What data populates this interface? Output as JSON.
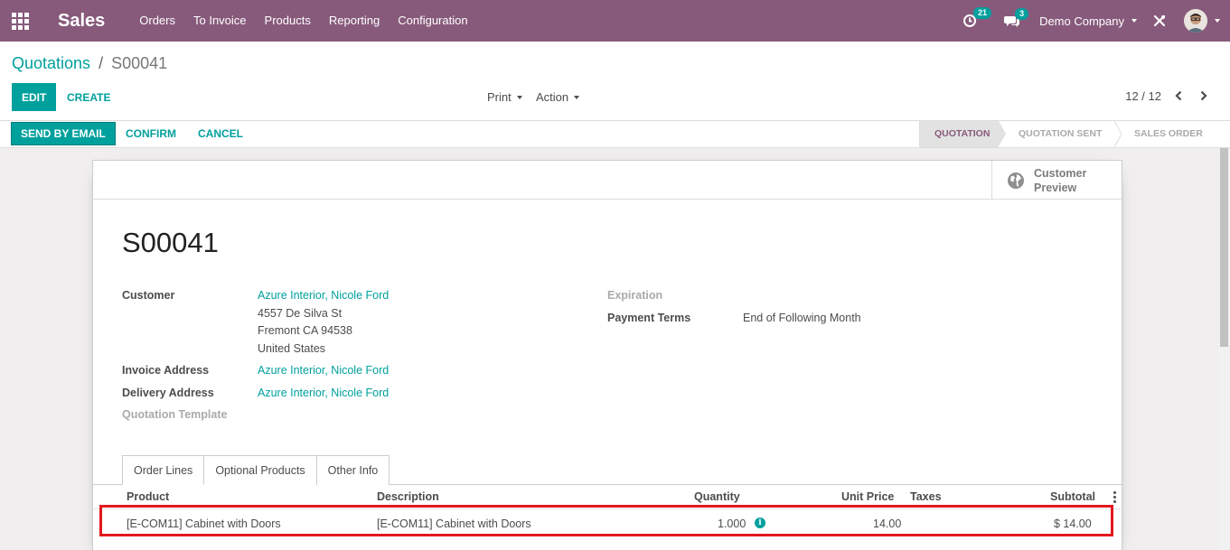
{
  "navbar": {
    "brand": "Sales",
    "menu": [
      "Orders",
      "To Invoice",
      "Products",
      "Reporting",
      "Configuration"
    ],
    "activity_count": "21",
    "message_count": "3",
    "company": "Demo Company",
    "brand_color": "#875a7b"
  },
  "control": {
    "breadcrumb_parent": "Quotations",
    "breadcrumb_sep": "/",
    "breadcrumb_current": "S00041",
    "edit_label": "EDIT",
    "create_label": "CREATE",
    "print_label": "Print",
    "action_label": "Action",
    "pager": "12 / 12"
  },
  "statusbar": {
    "send_label": "SEND BY EMAIL",
    "confirm_label": "CONFIRM",
    "cancel_label": "CANCEL",
    "stages": [
      "QUOTATION",
      "QUOTATION SENT",
      "SALES ORDER"
    ],
    "current_stage": "QUOTATION"
  },
  "sheet": {
    "preview_line1": "Customer",
    "preview_line2": "Preview",
    "title": "S00041",
    "fields": {
      "customer_label": "Customer",
      "customer_name": "Azure Interior, Nicole Ford",
      "address_line1": "4557 De Silva St",
      "address_line2": "Fremont CA 94538",
      "address_line3": "United States",
      "invoice_label": "Invoice Address",
      "invoice_value": "Azure Interior, Nicole Ford",
      "delivery_label": "Delivery Address",
      "delivery_value": "Azure Interior, Nicole Ford",
      "template_label": "Quotation Template",
      "expiration_label": "Expiration",
      "payment_label": "Payment Terms",
      "payment_value": "End of Following Month"
    },
    "tabs": [
      "Order Lines",
      "Optional Products",
      "Other Info"
    ],
    "columns": [
      "Product",
      "Description",
      "Quantity",
      "Unit Price",
      "Taxes",
      "Subtotal"
    ],
    "rows": [
      {
        "product": "[E-COM11] Cabinet with Doors",
        "description": "[E-COM11] Cabinet with Doors",
        "quantity": "1.000",
        "unit_price": "14.00",
        "taxes": "",
        "subtotal": "$ 14.00"
      }
    ]
  }
}
